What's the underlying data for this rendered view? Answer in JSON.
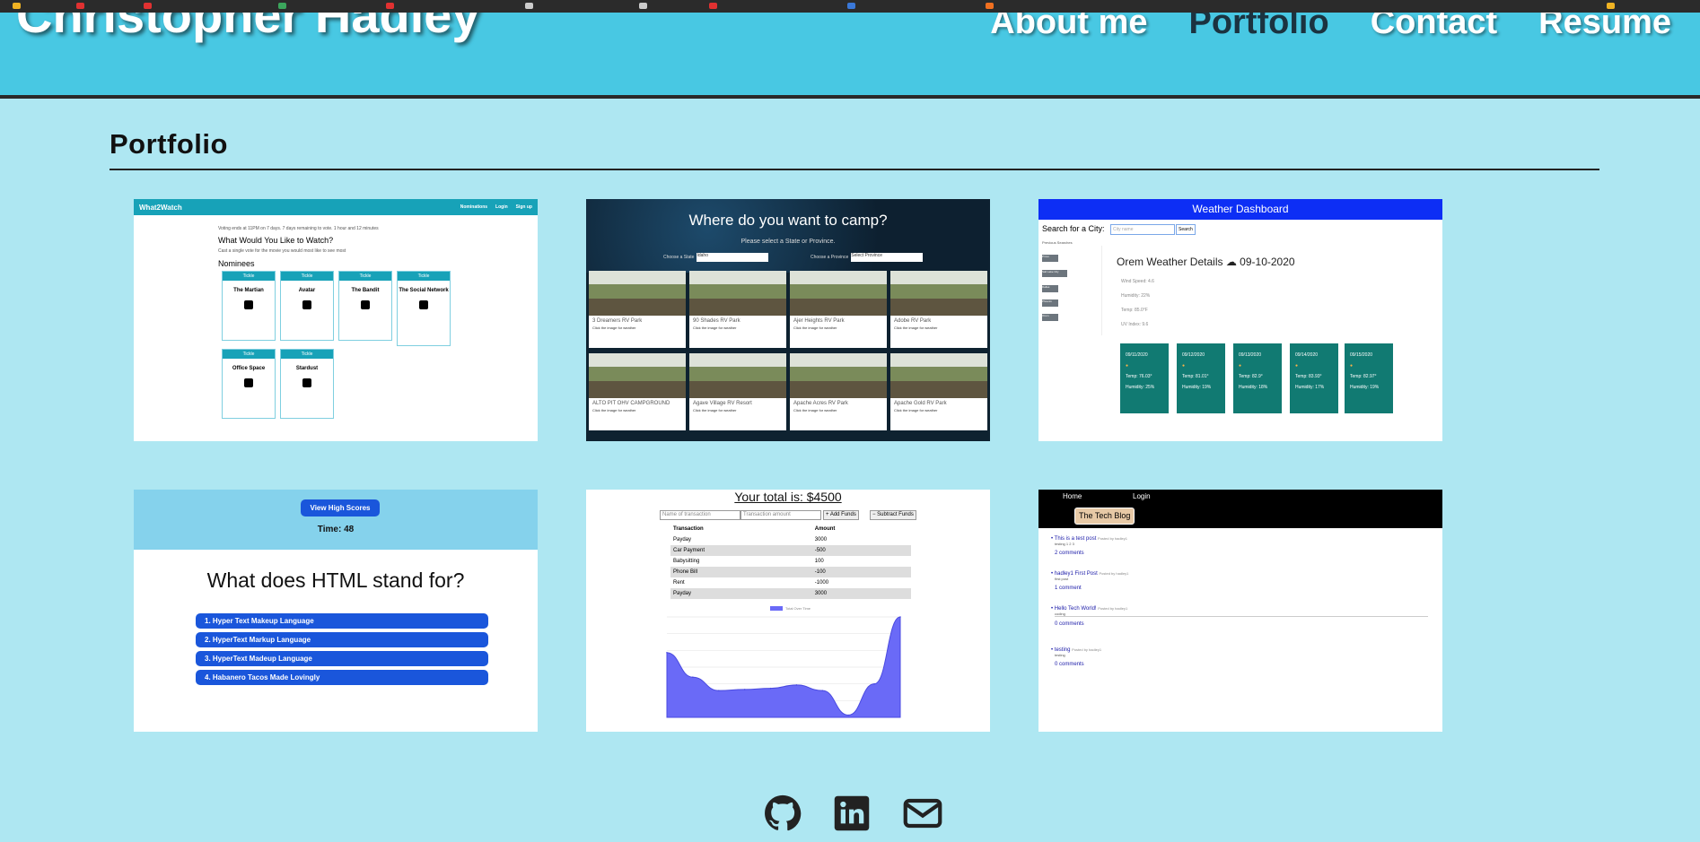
{
  "site": {
    "name": "Christopher Hadley",
    "nav": [
      "About me",
      "Portfolio",
      "Contact",
      "Resume"
    ],
    "active_nav": "Portfolio"
  },
  "portfolio": {
    "title": "Portfolio",
    "what2watch": {
      "brand": "What2Watch",
      "nav": [
        "Nominations",
        "Login",
        "Sign up"
      ],
      "intro": "Voting ends at 11PM on 7 days. 7 days remaining to vote. 1 hour and 12 minutes",
      "heading": "What Would You Like to Watch?",
      "sub": "Cast a single vote for the movie you would most like to see most",
      "nominees_label": "Nominees",
      "badge": "Tickle",
      "nominees": [
        "The Martian",
        "Avatar",
        "The Bandit",
        "The Social Network",
        "Office Space",
        "Stardust"
      ]
    },
    "campsite": {
      "question": "Where do you want to camp?",
      "prompt": "Please select a State or Province.",
      "state_label": "Choose a State",
      "state_value": "Idaho",
      "province_label": "Choose a Province",
      "province_value": "Select Province",
      "tile_caption": "Click the image for weather",
      "tiles": [
        "3 Dreamers RV Park",
        "90 Shades RV Park",
        "Ajer Heights RV Park",
        "Adobe RV Park",
        "ALTO PIT OHV CAMPGROUND",
        "Agave Village RV Resort",
        "Apache Acres RV Park",
        "Apache Gold RV Park"
      ]
    },
    "weather": {
      "title": "Weather Dashboard",
      "search_label": "Search for a City:",
      "search_placeholder": "City name",
      "search_button": "Search",
      "previous_label": "Previous Searches",
      "history": [
        "Provo",
        "Salt Lake City",
        "Dallas",
        "Phoenix",
        "Orem"
      ],
      "details": "Orem Weather Details",
      "date": "09-10-2020",
      "stats": [
        "Wind Speed: 4.6",
        "Humidity: 22%",
        "Temp: 85.0°F",
        "UV Index: 9.6"
      ],
      "forecast": [
        {
          "date": "09/11/2020",
          "temp": "Temp: 76.03°",
          "humidity": "Humidity: 25%"
        },
        {
          "date": "09/12/2020",
          "temp": "Temp: 81.01°",
          "humidity": "Humidity: 19%"
        },
        {
          "date": "09/13/2020",
          "temp": "Temp: 82.9°",
          "humidity": "Humidity: 18%"
        },
        {
          "date": "09/14/2020",
          "temp": "Temp: 83.93°",
          "humidity": "Humidity: 17%"
        },
        {
          "date": "09/15/2020",
          "temp": "Temp: 82.97°",
          "humidity": "Humidity: 19%"
        }
      ]
    },
    "quiz": {
      "high_scores": "View High Scores",
      "time": "Time: 48",
      "question": "What does HTML stand for?",
      "answers": [
        "1. Hyper Text Makeup Language",
        "2. HyperText Markup Language",
        "3. HyperText Madeup Language",
        "4. Habanero Tacos Made Lovingly"
      ]
    },
    "budget": {
      "total": "Your total is: $4500",
      "name_placeholder": "Name of transaction",
      "amount_placeholder": "Transaction amount",
      "add_button": "+ Add Funds",
      "subtract_button": "− Subtract Funds",
      "headers": [
        "Transaction",
        "Amount"
      ],
      "rows": [
        [
          "Payday",
          "3000"
        ],
        [
          "Car Payment",
          "-500"
        ],
        [
          "Babysitting",
          "100"
        ],
        [
          "Phone Bill",
          "-100"
        ],
        [
          "Rent",
          "-1000"
        ],
        [
          "Payday",
          "3000"
        ]
      ],
      "legend": "Total Over Time"
    },
    "blog": {
      "nav": [
        "Home",
        "Login"
      ],
      "logo": "The Tech Blog",
      "posts": [
        {
          "title": "This is a test post",
          "comments": "2 comments"
        },
        {
          "title": "hadley1 First Post",
          "comments": "1 comment"
        },
        {
          "title": "Hello Tech World!",
          "comments": "0 comments"
        },
        {
          "title": "testing",
          "comments": "0 comments"
        }
      ]
    }
  },
  "social": [
    "github-icon",
    "linkedin-icon",
    "envelope-icon"
  ],
  "colors": {
    "page_bg": "#aee7f2",
    "header_bg": "#48c8e3",
    "nav_active": "#1b3340",
    "weather_bar": "#0d2ef5",
    "forecast_card": "#117a72",
    "quiz_button": "#1a56db",
    "chart_fill": "#6a6af7"
  },
  "chart_data": {
    "type": "area",
    "series": [
      {
        "name": "Total Over Time",
        "values": [
          2900,
          1800,
          1200,
          1250,
          1300,
          1450,
          1200,
          100,
          1500,
          4500
        ]
      }
    ],
    "ylim": [
      0,
      4500
    ]
  }
}
